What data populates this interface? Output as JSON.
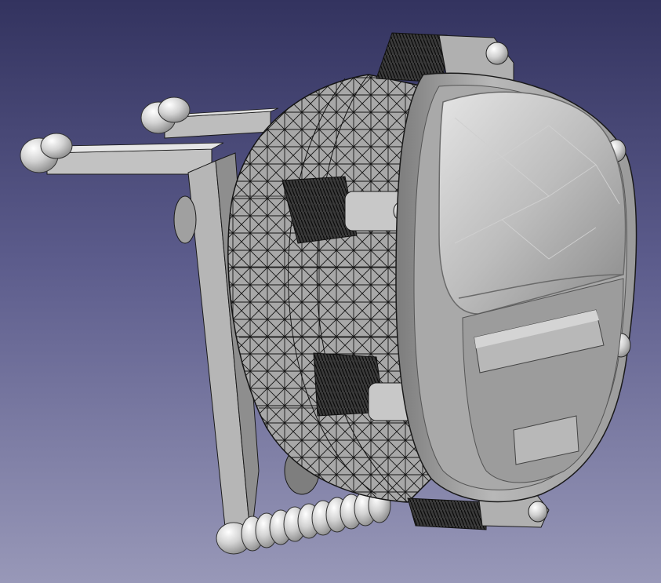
{
  "viewport": {
    "background_top": "#33335f",
    "background_bottom": "#9898b8",
    "model": {
      "shaded_color": "#b4b4b4",
      "shaded_dark": "#8e8e8e",
      "wire_color": "#141414",
      "highlight": "#e2e2e2"
    }
  }
}
